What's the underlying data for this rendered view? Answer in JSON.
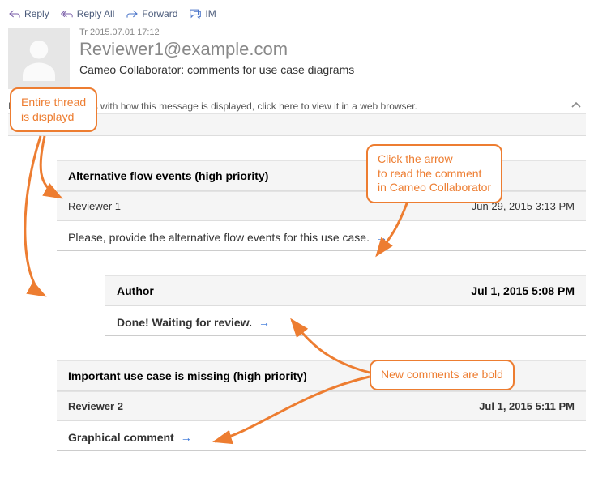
{
  "toolbar": {
    "reply": "Reply",
    "reply_all": "Reply All",
    "forward": "Forward",
    "im": "IM"
  },
  "header": {
    "timestamp": "Tr 2015.07.01 17:12",
    "from": "Reviewer1@example.com",
    "subject": "Cameo Collaborator: comments for use case diagrams"
  },
  "hint": "If there are problems with how this message is displayed, click here to view it in a web browser.",
  "threads": [
    {
      "title": "Alternative flow events (high priority)",
      "items": [
        {
          "author": "Reviewer 1",
          "date": "Jun 29, 2015 3:13 PM",
          "body": "Please, provide the alternative flow events for this use case.",
          "bold": false,
          "indent": 1
        },
        {
          "author": "Author",
          "date": "Jul 1, 2015 5:08 PM",
          "body": "Done! Waiting for review.",
          "bold": true,
          "indent": 2
        }
      ]
    },
    {
      "title": "Important use case is missing (high priority)",
      "items": [
        {
          "author": "Reviewer 2",
          "date": "Jul 1, 2015 5:11 PM",
          "body": "Graphical comment",
          "bold": true,
          "indent": 1
        }
      ]
    }
  ],
  "callouts": {
    "c1": "Entire thread\nis displayd",
    "c2": "Click the arrow\nto read the comment\nin Cameo Collaborator",
    "c3": "New comments are bold"
  },
  "colors": {
    "accent": "#ed7d31",
    "link": "#2b6cd6"
  }
}
